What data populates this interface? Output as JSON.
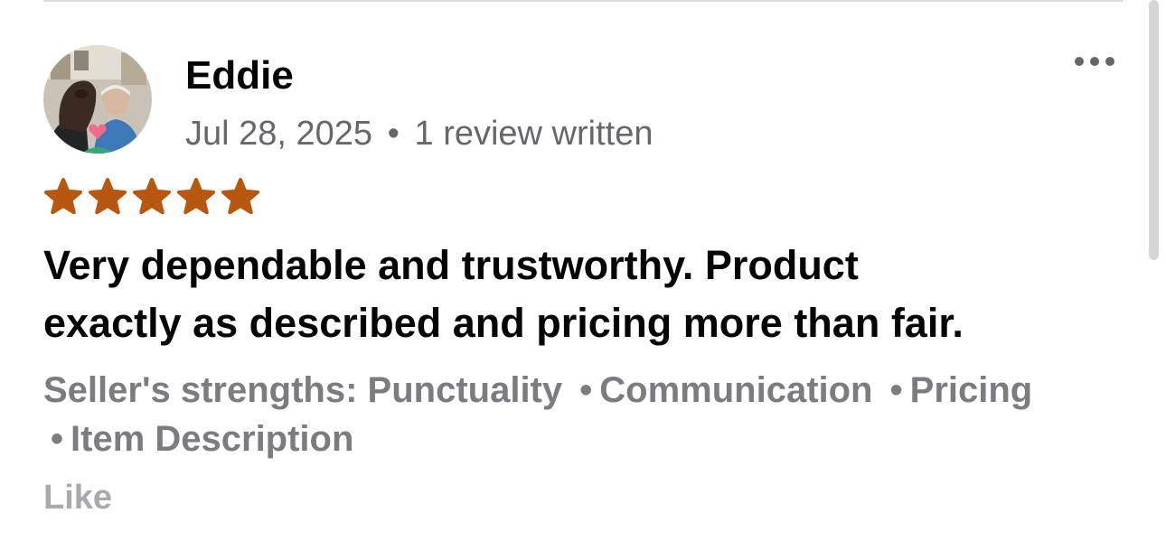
{
  "review": {
    "reviewer_name": "Eddie",
    "date": "Jul 28, 2025",
    "separator": "•",
    "reviews_written": "1 review written",
    "rating": 5,
    "max_rating": 5,
    "star_color": "#b8570f",
    "text_line1": "Very dependable and trustworthy.  Product",
    "text_line2": "exactly as described and pricing more than fair.",
    "strengths_label": "Seller's strengths:",
    "strengths": [
      "Punctuality",
      "Communication",
      "Pricing",
      "Item Description"
    ],
    "like_label": "Like",
    "more_icon": "more-horizontal-icon",
    "avatar_icon": "avatar-photo"
  }
}
